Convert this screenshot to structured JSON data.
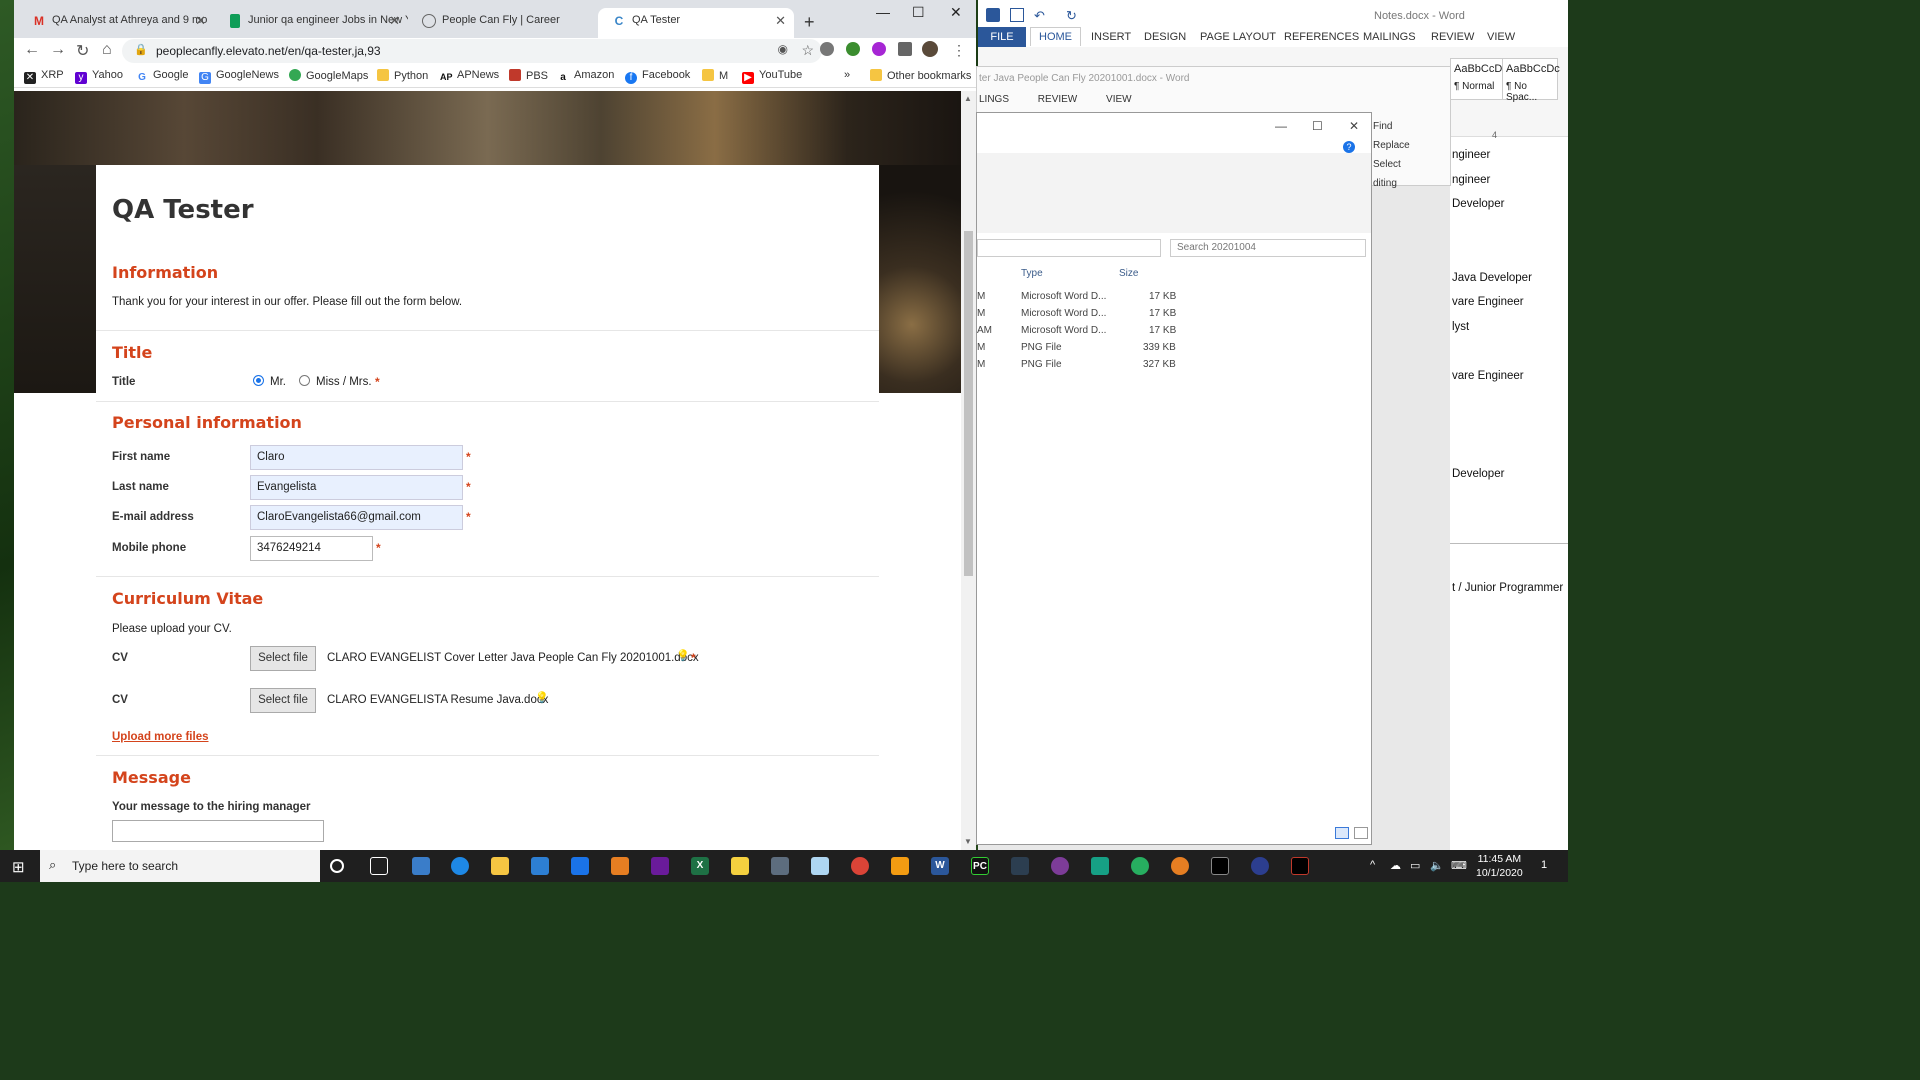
{
  "browser": {
    "tabs": [
      {
        "title": "QA Analyst at Athreya and 9 mo",
        "icon": "gmail-icon"
      },
      {
        "title": "Junior qa engineer Jobs in New Y",
        "icon": "sheets-icon"
      },
      {
        "title": "People Can Fly | Career",
        "icon": "pcf-icon"
      },
      {
        "title": "QA Tester",
        "icon": "elevato-icon"
      }
    ],
    "url": "peoplecanfly.elevato.net/en/qa-tester,ja,93",
    "bookmarks": [
      {
        "label": "XRP",
        "color": "#222"
      },
      {
        "label": "Yahoo",
        "color": "#6001d2"
      },
      {
        "label": "Google",
        "color": "#4285f4"
      },
      {
        "label": "GoogleNews",
        "color": "#4285f4"
      },
      {
        "label": "GoogleMaps",
        "color": "#34a853"
      },
      {
        "label": "Python",
        "color": "#f5c542"
      },
      {
        "label": "APNews",
        "color": "#111"
      },
      {
        "label": "PBS",
        "color": "#c0392b"
      },
      {
        "label": "Amazon",
        "color": "#111"
      },
      {
        "label": "Facebook",
        "color": "#1877f2"
      },
      {
        "label": "M",
        "color": "#f5c542"
      },
      {
        "label": "YouTube",
        "color": "#ff0000"
      }
    ],
    "bookmarks_overflow": "»",
    "other_bookmarks": "Other bookmarks"
  },
  "form": {
    "title": "QA Tester",
    "info_heading": "Information",
    "info_text": "Thank you for your interest in our offer. Please fill out the form below.",
    "title_heading": "Title",
    "title_label": "Title",
    "title_options": [
      "Mr.",
      "Miss / Mrs."
    ],
    "title_selected": "Mr.",
    "personal_heading": "Personal information",
    "first_name_label": "First name",
    "first_name": "Claro",
    "last_name_label": "Last name",
    "last_name": "Evangelista",
    "email_label": "E-mail address",
    "email": "ClaroEvangelista66@gmail.com",
    "phone_label": "Mobile phone",
    "phone": "3476249214",
    "required_mark": "*",
    "cv_heading": "Curriculum Vitae",
    "cv_text": "Please upload your CV.",
    "cv_label": "CV",
    "select_file": "Select file",
    "cv_files": [
      "CLARO EVANGELIST Cover Letter Java People Can Fly 20201001.docx",
      "CLARO EVANGELISTA Resume Java.docx"
    ],
    "upload_more": "Upload more files",
    "message_heading": "Message",
    "message_label": "Your message to the hiring manager"
  },
  "word": {
    "title": "Notes.docx - Word",
    "tabs": [
      "FILE",
      "HOME",
      "INSERT",
      "DESIGN",
      "PAGE LAYOUT",
      "REFERENCES",
      "MAILINGS",
      "REVIEW",
      "VIEW"
    ],
    "styles": [
      {
        "preview": "AaBbCcDc",
        "name": "¶ Normal"
      },
      {
        "preview": "AaBbCcDc",
        "name": "¶ No Spac..."
      }
    ],
    "ruler_mark": "4",
    "doc_lines": [
      "ngineer",
      "ngineer",
      "Developer",
      "Java Developer",
      "vare Engineer",
      "lyst",
      "vare Engineer",
      "Developer",
      "t / Junior Programmer"
    ]
  },
  "word2": {
    "title": "ter Java People Can Fly 20201001.docx - Word",
    "tabs": [
      "LINGS",
      "REVIEW",
      "VIEW"
    ],
    "editing": [
      "Find",
      "Replace",
      "Select",
      "diting"
    ]
  },
  "explorer": {
    "search_placeholder": "Search 20201004",
    "col_type": "Type",
    "col_size": "Size",
    "rows": [
      {
        "t": "M",
        "type": "Microsoft Word D...",
        "size": "17 KB"
      },
      {
        "t": "M",
        "type": "Microsoft Word D...",
        "size": "17 KB"
      },
      {
        "t": "AM",
        "type": "Microsoft Word D...",
        "size": "17 KB"
      },
      {
        "t": "M",
        "type": "PNG File",
        "size": "339 KB"
      },
      {
        "t": "M",
        "type": "PNG File",
        "size": "327 KB"
      }
    ]
  },
  "taskbar": {
    "search_placeholder": "Type here to search",
    "time": "11:45 AM",
    "date": "10/1/2020",
    "notifications": "1"
  }
}
